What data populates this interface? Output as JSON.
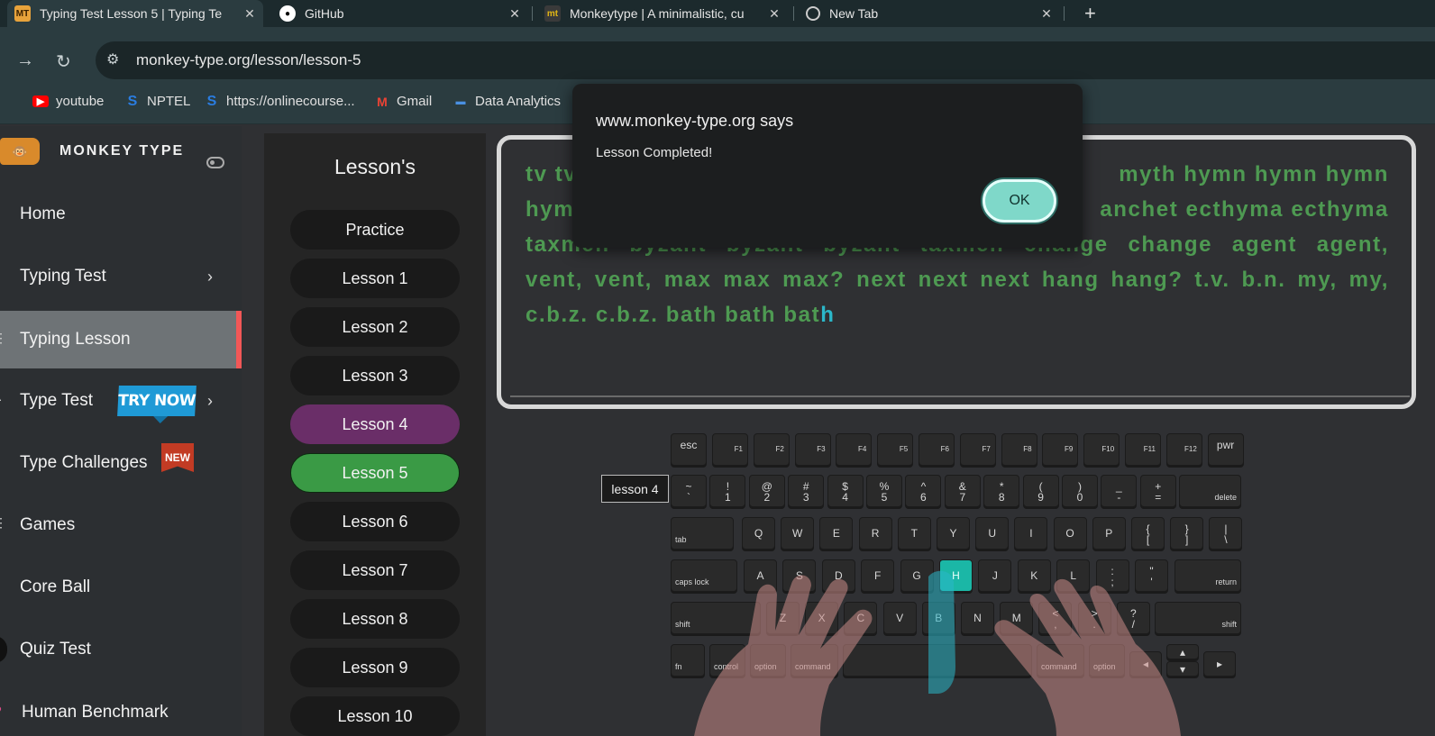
{
  "browser": {
    "tabs": [
      {
        "title": "Typing Test Lesson 5 | Typing Te",
        "favicon": "MT",
        "color": "#e8a33b",
        "active": true
      },
      {
        "title": "GitHub",
        "favicon": "github-icon",
        "color": "#ffffff",
        "active": false
      },
      {
        "title": "Monkeytype | A minimalistic, cu",
        "favicon": "mt",
        "color": "#e2b714",
        "active": false
      },
      {
        "title": "New Tab",
        "favicon": "chrome-icon",
        "color": "#cccccc",
        "active": false
      }
    ],
    "url": "monkey-type.org/lesson/lesson-5",
    "bookmarks": [
      {
        "label": "youtube",
        "icon": "youtube-icon",
        "color": "#ff0000"
      },
      {
        "label": "NPTEL",
        "icon": "s-icon",
        "color": "#2a7de1"
      },
      {
        "label": "https://onlinecourse...",
        "icon": "s-icon",
        "color": "#2a7de1"
      },
      {
        "label": "Gmail",
        "icon": "gmail-icon",
        "color": "#ea4335"
      },
      {
        "label": "Data Analytics",
        "icon": "data-icon",
        "color": "#4a90e2"
      }
    ]
  },
  "sidebar": {
    "brand": "MONKEY TYPE",
    "items": [
      {
        "label": "Home"
      },
      {
        "label": "Typing Test"
      },
      {
        "label": "Typing Lesson"
      },
      {
        "label": "Type Test"
      },
      {
        "label": "Type Challenges"
      },
      {
        "label": "Games"
      },
      {
        "label": "Core Ball"
      },
      {
        "label": "Quiz Test"
      },
      {
        "label": "Human Benchmark"
      }
    ],
    "try_now": "TRY NOW",
    "new_badge": "NEW"
  },
  "lessons": {
    "heading": "Lesson's",
    "items": [
      "Practice",
      "Lesson 1",
      "Lesson 2",
      "Lesson 3",
      "Lesson 4",
      "Lesson 5",
      "Lesson 6",
      "Lesson 7",
      "Lesson 8",
      "Lesson 9",
      "Lesson 10"
    ],
    "completed": "Lesson 4",
    "current": "Lesson 5"
  },
  "typing": {
    "line1_start": "tv tv",
    "line1_end": "myth hymn hymn hymn",
    "line2_start": "hym",
    "line2_end": "anchet ecthyma ecthyma",
    "line3": "taxmen byzant byzant byzant taxmen change change agent agent,",
    "line4": "vent, vent, max max max? next next next hang hang? t.v. b.n. my, my,",
    "line5": "c.b.z. c.b.z. bath bath bat",
    "cursor_char": "h"
  },
  "dialog": {
    "title": "www.monkey-type.org says",
    "message": "Lesson Completed!",
    "ok": "OK"
  },
  "keyboard": {
    "tooltip": "lesson 4",
    "active_key": "H",
    "fn_row": [
      "esc",
      "F1",
      "F2",
      "F3",
      "F4",
      "F5",
      "F6",
      "F7",
      "F8",
      "F9",
      "F10",
      "F11",
      "F12",
      "pwr"
    ],
    "num_row": [
      [
        "~",
        "`"
      ],
      [
        "!",
        "1"
      ],
      [
        "@",
        "2"
      ],
      [
        "#",
        "3"
      ],
      [
        "$",
        "4"
      ],
      [
        "%",
        "5"
      ],
      [
        "^",
        "6"
      ],
      [
        "&",
        "7"
      ],
      [
        "*",
        "8"
      ],
      [
        "(",
        "9"
      ],
      [
        ")",
        "0"
      ],
      [
        "_",
        "-"
      ],
      [
        "+",
        "="
      ]
    ],
    "delete": "delete",
    "tab": "tab",
    "q_row": [
      "Q",
      "W",
      "E",
      "R",
      "T",
      "Y",
      "U",
      "I",
      "O",
      "P"
    ],
    "q_row_sym": [
      [
        "{",
        "["
      ],
      [
        "}",
        "]"
      ],
      [
        "|",
        "\\"
      ]
    ],
    "caps": "caps lock",
    "a_row": [
      "A",
      "S",
      "D",
      "F",
      "G",
      "H",
      "J",
      "K",
      "L"
    ],
    "a_row_sym": [
      [
        ":",
        ";"
      ],
      [
        "\"",
        "'"
      ]
    ],
    "return": "return",
    "shift": "shift",
    "z_row": [
      "Z",
      "X",
      "C",
      "V",
      "B",
      "N",
      "M"
    ],
    "z_row_sym": [
      [
        "<",
        ","
      ],
      [
        ">",
        "."
      ],
      [
        "?",
        "/"
      ]
    ],
    "bottom": [
      "fn",
      "control",
      "option",
      "command",
      "",
      "command",
      "option"
    ],
    "arrows": [
      "◂",
      "▴",
      "▾",
      "▸"
    ]
  }
}
